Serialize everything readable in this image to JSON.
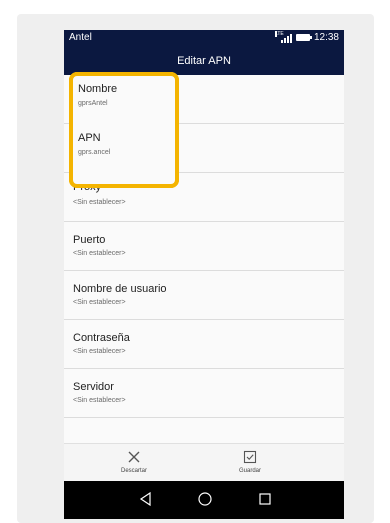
{
  "status": {
    "carrier": "Antel",
    "time": "12:38",
    "network": "LTE"
  },
  "title": "Editar APN",
  "fields": [
    {
      "label": "Nombre",
      "value": "gprsAntel"
    },
    {
      "label": "APN",
      "value": "gprs.ancel"
    },
    {
      "label": "Proxy",
      "value": "<Sin establecer>"
    },
    {
      "label": "Puerto",
      "value": "<Sin establecer>"
    },
    {
      "label": "Nombre de usuario",
      "value": "<Sin establecer>"
    },
    {
      "label": "Contraseña",
      "value": "<Sin establecer>"
    },
    {
      "label": "Servidor",
      "value": "<Sin establecer>"
    }
  ],
  "actions": {
    "discard": "Descartar",
    "save": "Guardar"
  },
  "colors": {
    "header": "#0b1840",
    "highlight": "#f4b400"
  },
  "icons": {
    "discard": "close-icon",
    "save": "save-icon",
    "back": "back-triangle-icon",
    "home": "home-circle-icon",
    "recents": "recents-square-icon"
  }
}
